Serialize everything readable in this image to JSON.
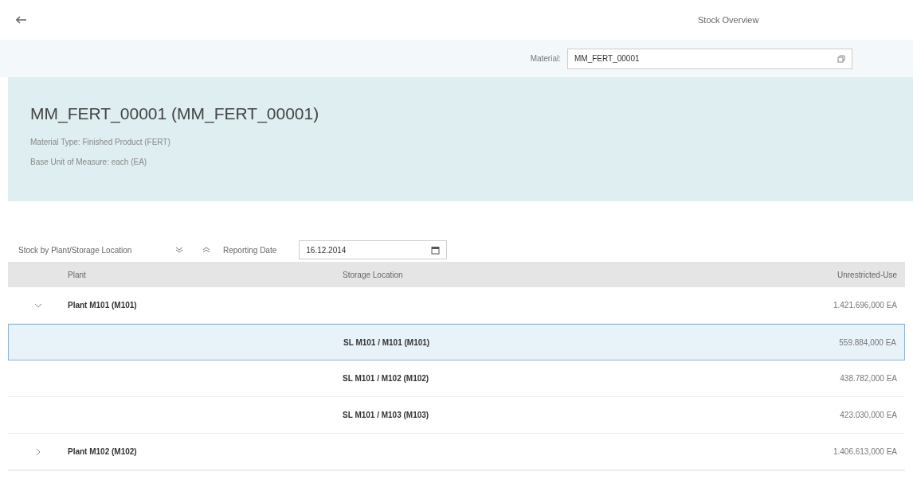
{
  "page": {
    "title": "Stock Overview"
  },
  "filter": {
    "label": "Material:",
    "value": "MM_FERT_00001"
  },
  "object_header": {
    "title": "MM_FERT_00001 (MM_FERT_00001)",
    "attributes": [
      "Material Type: Finished Product (FERT)",
      "Base Unit of Measure: each (EA)"
    ]
  },
  "table_toolbar": {
    "title": "Stock by Plant/Storage Location",
    "date_label": "Reporting Date",
    "date_value": "16.12.2014"
  },
  "table": {
    "columns": [
      "Plant",
      "Storage Location",
      "Unrestricted-Use"
    ],
    "rows": [
      {
        "kind": "plant",
        "expanded": true,
        "selected": false,
        "plant": "Plant M101 (M101)",
        "quantity": "1.421.696,000 EA"
      },
      {
        "kind": "location",
        "selected": true,
        "location": "SL M101 / M101 (M101)",
        "quantity": "559.884,000 EA"
      },
      {
        "kind": "location",
        "selected": false,
        "location": "SL M101 / M102 (M102)",
        "quantity": "438.782,000 EA"
      },
      {
        "kind": "location",
        "selected": false,
        "location": "SL M101 / M103 (M103)",
        "quantity": "423.030,000 EA"
      },
      {
        "kind": "plant",
        "expanded": false,
        "selected": false,
        "plant": "Plant M102 (M102)",
        "quantity": "1.406.613,000 EA"
      }
    ]
  }
}
